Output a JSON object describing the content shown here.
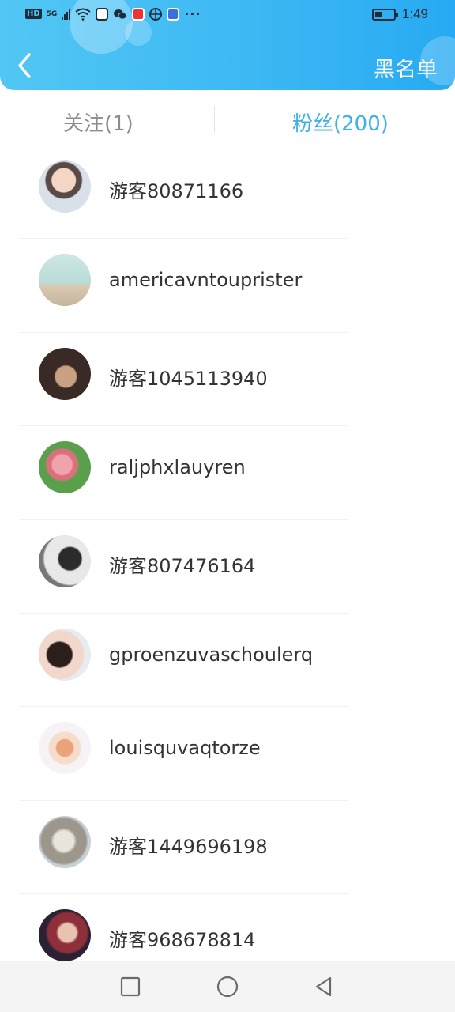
{
  "status_bar": {
    "hd": "HD",
    "network": "5G",
    "time": "1:49",
    "icons": [
      "hd-icon",
      "signal-icon",
      "wifi-icon",
      "music-app-icon",
      "wechat-icon",
      "red-app-icon",
      "browser-icon",
      "blue-app-icon",
      "more-dots-icon",
      "battery-icon"
    ],
    "dots": "···"
  },
  "header": {
    "back_icon": "chevron-left-icon",
    "blacklist_label": "黑名单",
    "gradient_colors": [
      "#52c7f5",
      "#27aaf3"
    ]
  },
  "tabs": {
    "follow_label": "关注(1)",
    "fans_label": "粉丝(200)",
    "active": "fans",
    "active_color": "#3fb0ea",
    "inactive_color": "#8c8c8c"
  },
  "fans": [
    {
      "name": "游客80871166",
      "avatar": "avatar-photo-young-man"
    },
    {
      "name": "americavntouprister",
      "avatar": "avatar-photo-beach"
    },
    {
      "name": "游客1045113940",
      "avatar": "avatar-photo-man"
    },
    {
      "name": "raljphxlauyren",
      "avatar": "avatar-photo-flower"
    },
    {
      "name": "游客807476164",
      "avatar": "avatar-photo-bw"
    },
    {
      "name": "gproenzuvaschoulerq",
      "avatar": "avatar-photo-woman"
    },
    {
      "name": "louisquvaqtorze",
      "avatar": "avatar-photo-food"
    },
    {
      "name": "游客1449696198",
      "avatar": "avatar-photo-cat"
    },
    {
      "name": "游客968678814",
      "avatar": "avatar-photo-game-character"
    }
  ],
  "navbar": {
    "buttons": [
      "recent-apps-icon",
      "home-icon",
      "back-triangle-icon"
    ]
  }
}
